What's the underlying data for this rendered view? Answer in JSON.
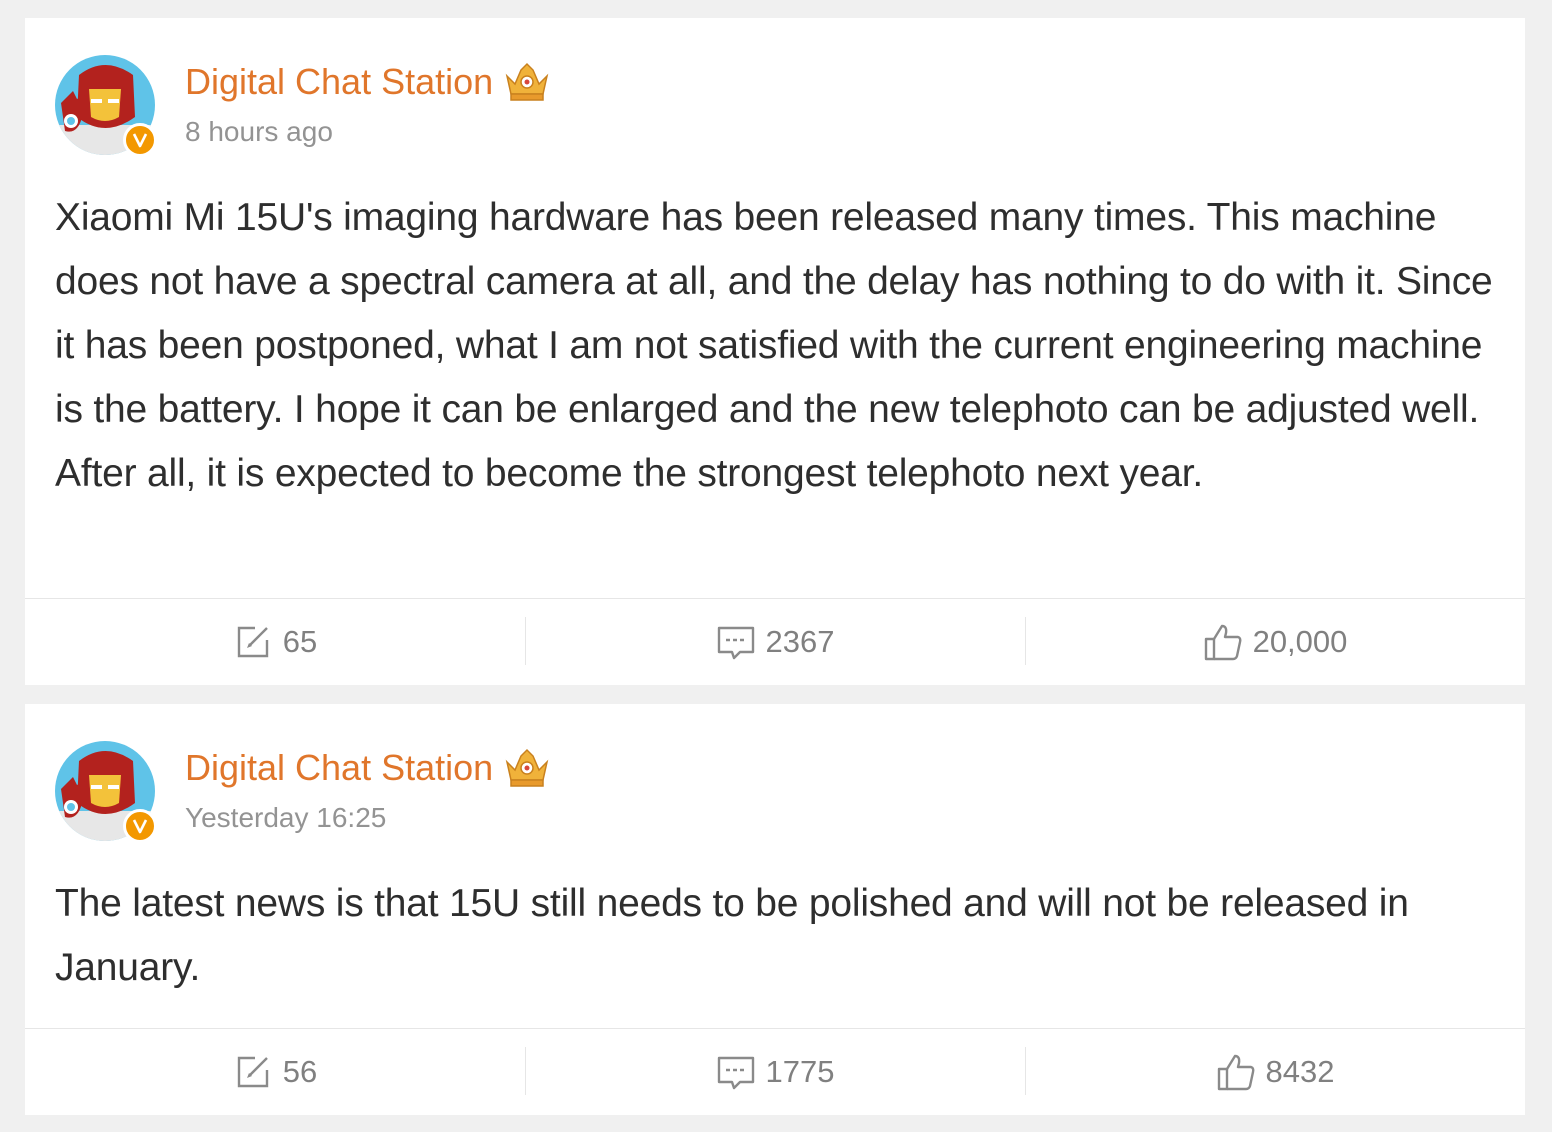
{
  "colors": {
    "author": "#e0762b",
    "timestamp": "#939393",
    "body_text": "#2e2e2e",
    "action_text": "#808080",
    "verified_badge": "#f39800",
    "background": "#f0f0f0"
  },
  "posts": [
    {
      "author": "Digital Chat Station",
      "author_badge_icon": "crown-badge-icon",
      "verified_icon": "verified-v-icon",
      "timestamp": "8 hours ago",
      "text": "Xiaomi Mi 15U's imaging hardware has been released many times. This machine does not have a spectral camera at all, and the delay has nothing to do with it. Since it has been postponed, what I am not satisfied with the current engineering machine is the battery. I hope it can be enlarged and the new telephoto can be adjusted well. After all, it is expected to become the strongest telephoto next year.",
      "reposts": "65",
      "comments": "2367",
      "likes": "20,000"
    },
    {
      "author": "Digital Chat Station",
      "author_badge_icon": "crown-badge-icon",
      "verified_icon": "verified-v-icon",
      "timestamp": "Yesterday 16:25",
      "text": "The latest news is that 15U still needs to be polished and will not be released in January.",
      "reposts": "56",
      "comments": "1775",
      "likes": "8432"
    }
  ]
}
